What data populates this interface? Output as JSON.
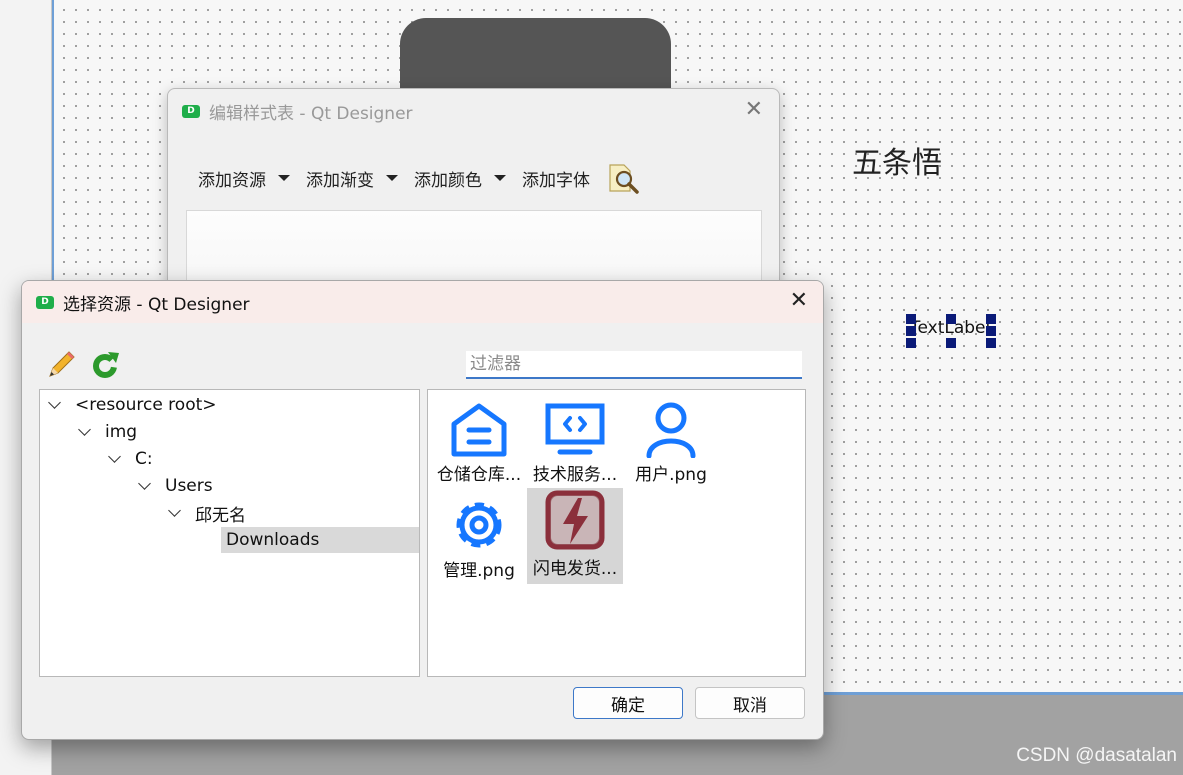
{
  "canvas": {
    "big_label": "五条悟",
    "text_label": "TextLabel"
  },
  "style_window": {
    "title": "编辑样式表 - Qt Designer",
    "app_icon_letter": "D",
    "toolbar": {
      "add_resource": "添加资源",
      "add_gradient": "添加渐变",
      "add_color": "添加颜色",
      "add_font": "添加字体"
    }
  },
  "resource_dialog": {
    "title": "选择资源 - Qt Designer",
    "app_icon_letter": "D",
    "filter_placeholder": "过滤器",
    "tree": [
      {
        "label": "<resource root>"
      },
      {
        "label": "img"
      },
      {
        "label": "C:"
      },
      {
        "label": "Users"
      },
      {
        "label": "邱无名"
      },
      {
        "label": "Downloads"
      }
    ],
    "resources": [
      {
        "label": "仓储仓库...",
        "icon": "warehouse-icon",
        "color": "#1677ff"
      },
      {
        "label": "技术服务...",
        "icon": "tech-service-icon",
        "color": "#1677ff"
      },
      {
        "label": "用户.png",
        "icon": "user-icon",
        "color": "#1677ff"
      },
      {
        "label": "管理.png",
        "icon": "gear-icon",
        "color": "#1677ff"
      },
      {
        "label": "闪电发货...",
        "icon": "lightning-icon",
        "color": "#8b2f3b"
      }
    ],
    "ok_label": "确定",
    "cancel_label": "取消"
  },
  "watermark": "CSDN @dasatalan",
  "colors": {
    "accent": "#3d78c8",
    "icon_blue": "#1677ff",
    "qt_green": "#1fae4a"
  }
}
